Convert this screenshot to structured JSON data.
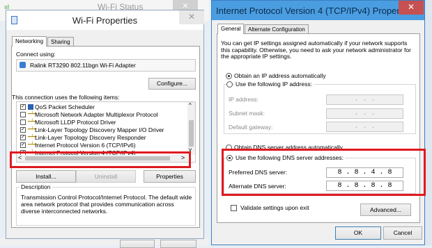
{
  "background": {
    "status_title": "Wi-Fi Status"
  },
  "wifi_props": {
    "title": "Wi-Fi Properties",
    "close": "✕",
    "tabs": [
      {
        "label": "Networking"
      },
      {
        "label": "Sharing"
      }
    ],
    "connect_using": "Connect using:",
    "adapter": "Ralink RT3290 802.11bgn Wi-Fi Adapter",
    "configure": "Configure...",
    "items_heading": "This connection uses the following items:",
    "items": [
      {
        "label": "QoS Packet Scheduler",
        "checked": true
      },
      {
        "label": "Microsoft Network Adapter Multiplexor Protocol",
        "checked": false
      },
      {
        "label": "Microsoft LLDP Protocol Driver",
        "checked": false
      },
      {
        "label": "Link-Layer Topology Discovery Mapper I/O Driver",
        "checked": true
      },
      {
        "label": "Link-Layer Topology Discovery Responder",
        "checked": true
      },
      {
        "label": "Internet Protocol Version 6 (TCP/IPv6)",
        "checked": true
      },
      {
        "label": "Internet Protocol Version 4 (TCP/IPv4)",
        "checked": true
      }
    ],
    "install": "Install...",
    "uninstall": "Uninstall",
    "properties": "Properties",
    "description_heading": "Description",
    "description": "Transmission Control Protocol/Internet Protocol. The default wide area network protocol that provides communication across diverse interconnected networks."
  },
  "ipv4": {
    "title": "Internet Protocol Version 4 (TCP/IPv4) Properties",
    "close": "✕",
    "tabs": [
      {
        "label": "General"
      },
      {
        "label": "Alternate Configuration"
      }
    ],
    "intro": "You can get IP settings assigned automatically if your network supports this capability. Otherwise, you need to ask your network administrator for the appropriate IP settings.",
    "obtain_ip_auto": "Obtain an IP address automatically",
    "use_following_ip": "Use the following IP address:",
    "ip_address_label": "IP address:",
    "subnet_label": "Subnet mask:",
    "gateway_label": "Default gateway:",
    "empty_ip": ".     .     .",
    "obtain_dns_auto": "Obtain DNS server address automatically",
    "use_following_dns": "Use the following DNS server addresses:",
    "preferred_dns_label": "Preferred DNS server:",
    "preferred_dns_value": "8 . 8 . 4 . 8",
    "alternate_dns_label": "Alternate DNS server:",
    "alternate_dns_value": "8 . 8 . 8 . 8",
    "validate": "Validate settings upon exit",
    "advanced": "Advanced...",
    "ok": "OK",
    "cancel": "Cancel"
  },
  "colors": {
    "highlight_box": "#e0191f",
    "close_button": "#c75050"
  }
}
